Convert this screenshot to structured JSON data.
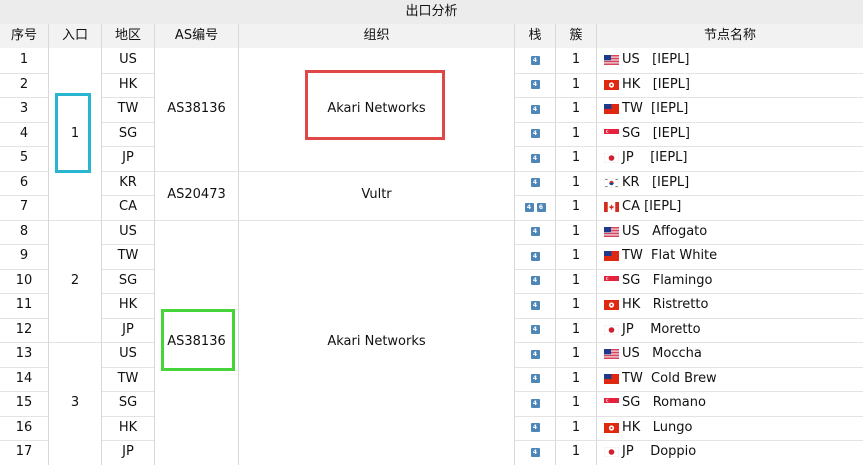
{
  "title": "出口分析",
  "headers": {
    "seq": "序号",
    "entry": "入口",
    "region": "地区",
    "asn": "AS编号",
    "org": "组织",
    "stack": "栈",
    "cluster": "簇",
    "node_name": "节点名称"
  },
  "rows": [
    {
      "seq": "1",
      "region": "US",
      "stack": [
        "4"
      ],
      "cluster": "1",
      "flag": "US",
      "name": "US   [IEPL]"
    },
    {
      "seq": "2",
      "region": "HK",
      "stack": [
        "4"
      ],
      "cluster": "1",
      "flag": "HK",
      "name": "HK   [IEPL]"
    },
    {
      "seq": "3",
      "region": "TW",
      "stack": [
        "4"
      ],
      "cluster": "1",
      "flag": "TW",
      "name": "TW  [IEPL]"
    },
    {
      "seq": "4",
      "region": "SG",
      "stack": [
        "4"
      ],
      "cluster": "1",
      "flag": "SG",
      "name": "SG   [IEPL]"
    },
    {
      "seq": "5",
      "region": "JP",
      "stack": [
        "4"
      ],
      "cluster": "1",
      "flag": "JP",
      "name": "JP    [IEPL]"
    },
    {
      "seq": "6",
      "region": "KR",
      "stack": [
        "4"
      ],
      "cluster": "1",
      "flag": "KR",
      "name": "KR   [IEPL]"
    },
    {
      "seq": "7",
      "region": "CA",
      "stack": [
        "4",
        "6"
      ],
      "cluster": "1",
      "flag": "CA",
      "name": "CA [IEPL]"
    },
    {
      "seq": "8",
      "region": "US",
      "stack": [
        "4"
      ],
      "cluster": "1",
      "flag": "US",
      "name": "US   Affogato"
    },
    {
      "seq": "9",
      "region": "TW",
      "stack": [
        "4"
      ],
      "cluster": "1",
      "flag": "TW",
      "name": "TW  Flat White"
    },
    {
      "seq": "10",
      "region": "SG",
      "stack": [
        "4"
      ],
      "cluster": "1",
      "flag": "SG",
      "name": "SG   Flamingo"
    },
    {
      "seq": "11",
      "region": "HK",
      "stack": [
        "4"
      ],
      "cluster": "1",
      "flag": "HK",
      "name": "HK   Ristretto"
    },
    {
      "seq": "12",
      "region": "JP",
      "stack": [
        "4"
      ],
      "cluster": "1",
      "flag": "JP",
      "name": "JP    Moretto"
    },
    {
      "seq": "13",
      "region": "US",
      "stack": [
        "4"
      ],
      "cluster": "1",
      "flag": "US",
      "name": "US   Moccha"
    },
    {
      "seq": "14",
      "region": "TW",
      "stack": [
        "4"
      ],
      "cluster": "1",
      "flag": "TW",
      "name": "TW  Cold Brew"
    },
    {
      "seq": "15",
      "region": "SG",
      "stack": [
        "4"
      ],
      "cluster": "1",
      "flag": "SG",
      "name": "SG   Romano"
    },
    {
      "seq": "16",
      "region": "HK",
      "stack": [
        "4"
      ],
      "cluster": "1",
      "flag": "HK",
      "name": "HK   Lungo"
    },
    {
      "seq": "17",
      "region": "JP",
      "stack": [
        "4"
      ],
      "cluster": "1",
      "flag": "JP",
      "name": "JP    Doppio"
    }
  ],
  "entry_groups": [
    {
      "label": "1",
      "from": 1,
      "to": 7
    },
    {
      "label": "2",
      "from": 8,
      "to": 12
    },
    {
      "label": "3",
      "from": 13,
      "to": 17
    }
  ],
  "asn_groups": [
    {
      "asn": "AS38136",
      "org": "Akari Networks",
      "from": 1,
      "to": 5
    },
    {
      "asn": "AS20473",
      "org": "Vultr",
      "from": 6,
      "to": 7
    },
    {
      "asn": "AS38136",
      "org": "Akari Networks",
      "from": 8,
      "to": 17
    }
  ],
  "highlights": [
    {
      "target": "entry-1",
      "color": "#29b5cf"
    },
    {
      "target": "org-1",
      "color": "#e04848"
    },
    {
      "target": "asn-3",
      "color": "#45d43a"
    }
  ]
}
